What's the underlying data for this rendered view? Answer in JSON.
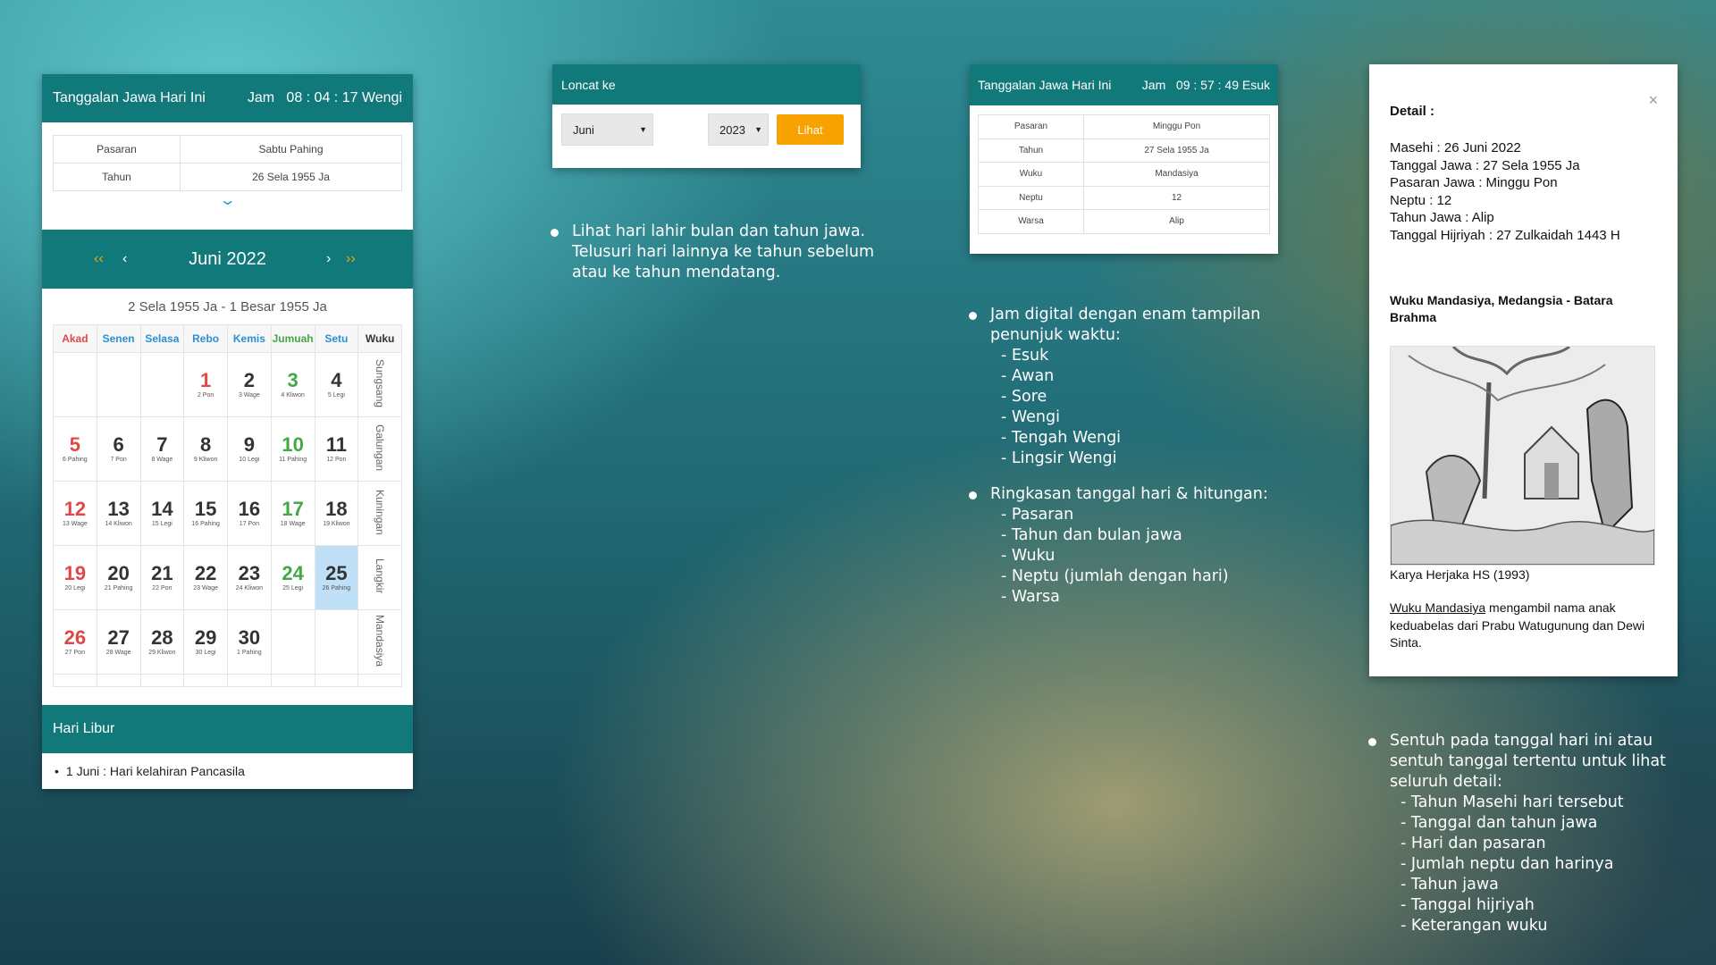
{
  "panel1": {
    "title": "Tanggalan Jawa Hari Ini",
    "clock_label": "Jam",
    "clock_time": "08 : 04 : 17 Wengi",
    "info": [
      {
        "label": "Pasaran",
        "value": "Sabtu Pahing"
      },
      {
        "label": "Tahun",
        "value": "26 Sela 1955 Ja"
      }
    ],
    "expand_icon": "chevron-down-icon",
    "month_title": "Juni 2022",
    "nav": {
      "prev_year": "‹‹",
      "prev_month": "‹",
      "next_month": "›",
      "next_year": "››"
    },
    "range": "2 Sela 1955 Ja - 1 Besar 1955 Ja",
    "weekdays": [
      "Akad",
      "Senen",
      "Selasa",
      "Rebo",
      "Kemis",
      "Jumuah",
      "Setu",
      "Wuku"
    ],
    "weeks": [
      {
        "wuku": "Sungsang",
        "days": [
          null,
          null,
          null,
          {
            "n": "1",
            "p": "2 Pon",
            "c": "red"
          },
          {
            "n": "2",
            "p": "3 Wage"
          },
          {
            "n": "3",
            "p": "4 Kliwon",
            "c": "green"
          },
          {
            "n": "4",
            "p": "5 Legi"
          }
        ]
      },
      {
        "wuku": "Galungan",
        "days": [
          {
            "n": "5",
            "p": "6 Pahing",
            "c": "red"
          },
          {
            "n": "6",
            "p": "7 Pon"
          },
          {
            "n": "7",
            "p": "8 Wage"
          },
          {
            "n": "8",
            "p": "9 Kliwon"
          },
          {
            "n": "9",
            "p": "10 Legi"
          },
          {
            "n": "10",
            "p": "11 Pahing",
            "c": "green"
          },
          {
            "n": "11",
            "p": "12 Pon"
          }
        ]
      },
      {
        "wuku": "Kuningan",
        "days": [
          {
            "n": "12",
            "p": "13 Wage",
            "c": "red"
          },
          {
            "n": "13",
            "p": "14 Kliwon"
          },
          {
            "n": "14",
            "p": "15 Legi"
          },
          {
            "n": "15",
            "p": "16 Pahing"
          },
          {
            "n": "16",
            "p": "17 Pon"
          },
          {
            "n": "17",
            "p": "18 Wage",
            "c": "green"
          },
          {
            "n": "18",
            "p": "19 Kliwon"
          }
        ]
      },
      {
        "wuku": "Langkir",
        "days": [
          {
            "n": "19",
            "p": "20 Legi",
            "c": "red"
          },
          {
            "n": "20",
            "p": "21 Pahing"
          },
          {
            "n": "21",
            "p": "22 Pon"
          },
          {
            "n": "22",
            "p": "23 Wage"
          },
          {
            "n": "23",
            "p": "24 Kliwon"
          },
          {
            "n": "24",
            "p": "25 Legi",
            "c": "green"
          },
          {
            "n": "25",
            "p": "26 Pahing",
            "today": true
          }
        ]
      },
      {
        "wuku": "Mandasiya",
        "days": [
          {
            "n": "26",
            "p": "27 Pon",
            "c": "red"
          },
          {
            "n": "27",
            "p": "28 Wage"
          },
          {
            "n": "28",
            "p": "29 Kliwon"
          },
          {
            "n": "29",
            "p": "30 Legi"
          },
          {
            "n": "30",
            "p": "1 Pahing"
          },
          null,
          null
        ]
      }
    ],
    "holiday_title": "Hari Libur",
    "holidays": [
      "1 Juni : Hari kelahiran Pancasila"
    ]
  },
  "panel2": {
    "title": "Loncat ke",
    "month_value": "Juni",
    "year_value": "2023",
    "button": "Lihat"
  },
  "panel3": {
    "title": "Tanggalan Jawa Hari Ini",
    "clock_label": "Jam",
    "clock_time": "09 : 57 : 49 Esuk",
    "info": [
      {
        "label": "Pasaran",
        "value": "Minggu Pon"
      },
      {
        "label": "Tahun",
        "value": "27 Sela 1955 Ja"
      },
      {
        "label": "Wuku",
        "value": "Mandasiya"
      },
      {
        "label": "Neptu",
        "value": "12"
      },
      {
        "label": "Warsa",
        "value": "Alip"
      }
    ]
  },
  "panel4": {
    "close": "×",
    "title": "Detail :",
    "lines": [
      "Masehi : 26 Juni 2022",
      "Tanggal Jawa : 27 Sela 1955 Ja",
      "Pasaran Jawa : Minggu Pon",
      "Neptu : 12",
      "Tahun Jawa : Alip",
      "Tanggal Hijriyah : 27 Zulkaidah 1443 H"
    ],
    "wuku_title": "Wuku Mandasiya, Medangsia - Batara Brahma",
    "image_caption": "Karya Herjaka HS (1993)",
    "desc_link": "Wuku Mandasiya",
    "desc_rest": " mengambil nama anak keduabelas dari Prabu Watugunung dan Dewi Sinta."
  },
  "bullets1": {
    "items": [
      {
        "text": "Lihat hari lahir bulan dan tahun jawa. Telusuri hari lainnya ke tahun sebelum atau ke tahun mendatang.",
        "subs": []
      }
    ]
  },
  "bullets2": {
    "items": [
      {
        "text": "Jam digital dengan enam tampilan penunjuk waktu:",
        "subs": [
          "- Esuk",
          "- Awan",
          "- Sore",
          "- Wengi",
          "- Tengah Wengi",
          "- Lingsir Wengi"
        ]
      },
      {
        "text": "Ringkasan tanggal hari & hitungan:",
        "subs": [
          "- Pasaran",
          "- Tahun dan bulan jawa",
          "- Wuku",
          "- Neptu (jumlah dengan hari)",
          "- Warsa"
        ]
      }
    ]
  },
  "bullets3": {
    "items": [
      {
        "text": "Sentuh pada tanggal hari ini atau sentuh tanggal tertentu untuk lihat seluruh detail:",
        "subs": [
          "- Tahun Masehi hari tersebut",
          "- Tanggal dan tahun jawa",
          "- Hari dan pasaran",
          "- Jumlah neptu dan harinya",
          "- Tahun jawa",
          "- Tanggal hijriyah",
          "- Keterangan wuku"
        ]
      }
    ]
  },
  "colors": {
    "teal": "#12797a",
    "accent": "#f8a200",
    "sunday": "#e04848",
    "friday": "#43a843",
    "weekday_header": "#2b8fd4",
    "today": "#bfe0f7"
  }
}
